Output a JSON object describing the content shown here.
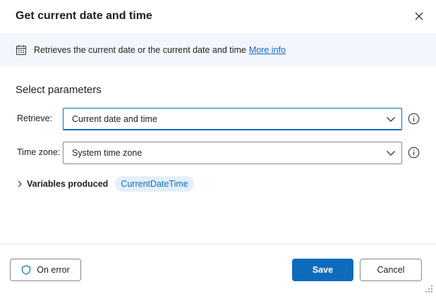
{
  "dialog": {
    "title": "Get current date and time",
    "close_icon": "close-icon"
  },
  "info": {
    "icon": "calendar-icon",
    "description": "Retrieves the current date or the current date and time",
    "link_text": "More info"
  },
  "parameters": {
    "section_title": "Select parameters",
    "retrieve": {
      "label": "Retrieve:",
      "value": "Current date and time"
    },
    "time_zone": {
      "label": "Time zone:",
      "value": "System time zone"
    }
  },
  "variables": {
    "label": "Variables produced",
    "items": [
      "CurrentDateTime"
    ]
  },
  "footer": {
    "on_error_label": "On error",
    "save_label": "Save",
    "cancel_label": "Cancel"
  },
  "colors": {
    "accent": "#0f6cbd",
    "info_bar_bg": "#f3f6fc",
    "pill_bg": "#e5effa",
    "border": "#8a8886"
  }
}
